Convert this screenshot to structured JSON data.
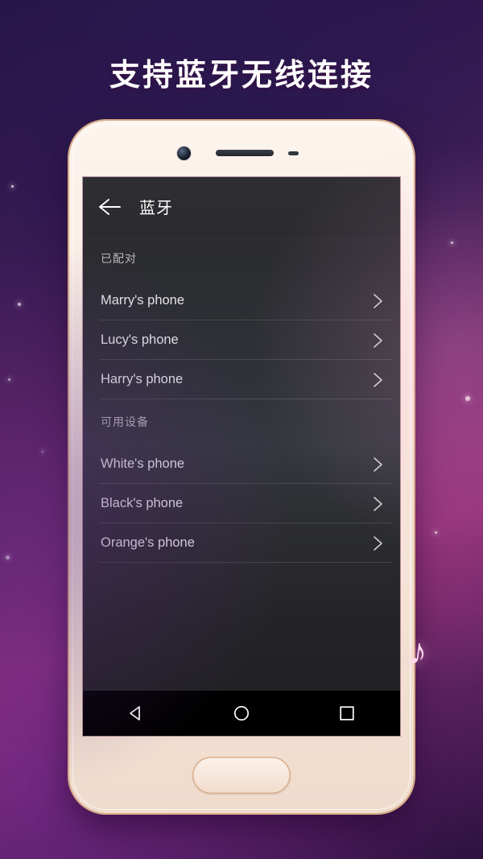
{
  "headline": "支持蓝牙无线连接",
  "phone": {
    "camera_icon": "front-camera",
    "speaker_icon": "earpiece-speaker",
    "sensor_icon": "proximity-sensor",
    "home_button": "home-button"
  },
  "app": {
    "appbar": {
      "back_icon": "arrow-left-icon",
      "title": "蓝牙"
    },
    "sections": [
      {
        "header": "已配对",
        "items": [
          {
            "label": "Marry's phone",
            "chevron_icon": "chevron-right-icon"
          },
          {
            "label": "Lucy's phone",
            "chevron_icon": "chevron-right-icon"
          },
          {
            "label": "Harry's phone",
            "chevron_icon": "chevron-right-icon"
          }
        ]
      },
      {
        "header": "可用设备",
        "items": [
          {
            "label": "White's phone",
            "chevron_icon": "chevron-right-icon"
          },
          {
            "label": "Black's phone",
            "chevron_icon": "chevron-right-icon"
          },
          {
            "label": "Orange's phone",
            "chevron_icon": "chevron-right-icon"
          }
        ]
      }
    ],
    "navbar": {
      "back": "triangle-back-icon",
      "home": "circle-home-icon",
      "recents": "square-recents-icon"
    }
  },
  "decor": {
    "music_note": "♪"
  },
  "colors": {
    "accent_note": "#ffd8ec",
    "screen_bg": "#2e3136",
    "navbar_bg": "#000000",
    "text_primary": "#e8e8ea",
    "text_secondary": "#b9b9bc"
  }
}
